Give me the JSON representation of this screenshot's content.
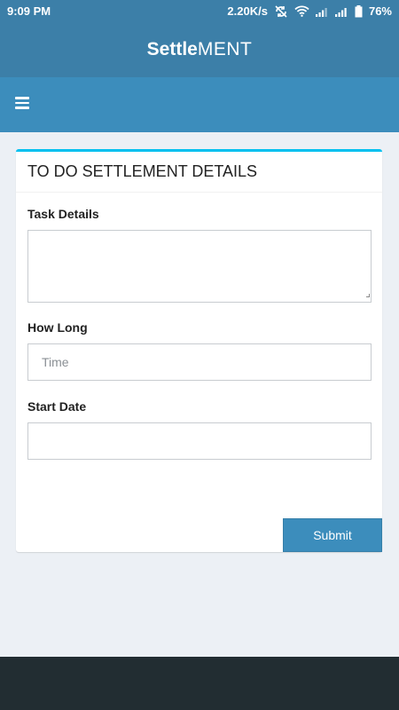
{
  "status_bar": {
    "time": "9:09 PM",
    "net_speed": "2.20K/s",
    "battery": "76%",
    "icons": [
      "sync-off-icon",
      "wifi-icon",
      "signal-icon",
      "signal-icon",
      "battery-icon"
    ]
  },
  "header": {
    "brand_bold": "Settle",
    "brand_light": "MENT"
  },
  "nav": {
    "menu_icon": "hamburger-menu-icon"
  },
  "form": {
    "title": "TO DO SETTLEMENT DETAILS",
    "task_details_label": "Task Details",
    "task_details_value": "",
    "how_long_label": "How Long",
    "how_long_placeholder": "Time",
    "how_long_value": "",
    "start_date_label": "Start Date",
    "start_date_value": "",
    "submit_label": "Submit"
  },
  "colors": {
    "header_bg": "#3c7fa8",
    "nav_bg": "#3c8dbc",
    "card_accent": "#00c0ef",
    "page_bg": "#ecf0f5",
    "footer_bg": "#222d32",
    "button_bg": "#3c8dbc"
  }
}
